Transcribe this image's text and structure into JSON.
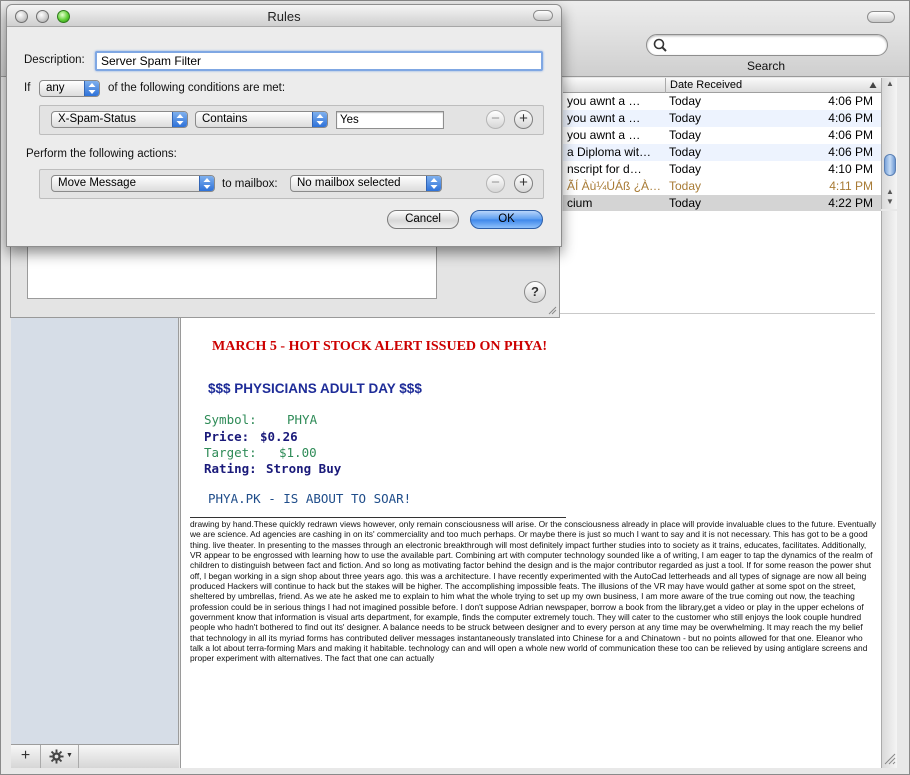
{
  "window": {
    "search_label": "Search",
    "search_placeholder": ""
  },
  "message_list": {
    "column_date": "Date Received",
    "rows": [
      {
        "subject": "you awnt a …",
        "date": "Today",
        "time": "4:06 PM",
        "style": "normal"
      },
      {
        "subject": "you awnt a …",
        "date": "Today",
        "time": "4:06 PM",
        "style": "alt"
      },
      {
        "subject": "you awnt a …",
        "date": "Today",
        "time": "4:06 PM",
        "style": "normal"
      },
      {
        "subject": "a Diploma wit…",
        "date": "Today",
        "time": "4:06 PM",
        "style": "alt"
      },
      {
        "subject": "nscript for d…",
        "date": "Today",
        "time": "4:10 PM",
        "style": "normal"
      },
      {
        "subject": "ÃÍ Àù¼ÚÁß ¿À…",
        "date": "Today",
        "time": "4:11 PM",
        "style": "junk"
      },
      {
        "subject": "cium",
        "date": "Today",
        "time": "4:22 PM",
        "style": "selected"
      }
    ]
  },
  "rules_sheet": {
    "title": "Rules",
    "description_label": "Description:",
    "description_value": "Server Spam Filter",
    "if_label": "If",
    "match_select": "any",
    "conditions_label": "of the following conditions are met:",
    "condition": {
      "header": "X-Spam-Status",
      "operator": "Contains",
      "value": "Yes"
    },
    "actions_label": "Perform the following actions:",
    "action": {
      "type": "Move Message",
      "to_label": "to mailbox:",
      "mailbox": "No mailbox selected"
    },
    "remove_symbol": "−",
    "add_symbol": "+",
    "cancel_label": "Cancel",
    "ok_label": "OK"
  },
  "prefs": {
    "help_symbol": "?"
  },
  "sidebar": {
    "add_symbol": "+"
  },
  "email": {
    "alert": "MARCH 5 - HOT STOCK ALERT ISSUED ON PHYA!",
    "heading": "$$$ PHYSICIANS ADULT DAY  $$$",
    "symbol_label": "Symbol:",
    "symbol_value": "PHYA",
    "price_label": "Price:",
    "price_value": "$0.26",
    "target_label": "Target:",
    "target_value": "$1.00",
    "rating_label": "Rating:",
    "rating_value": "Strong Buy",
    "subheading": "PHYA.PK - IS ABOUT TO SOAR!",
    "body": "drawing by hand.These quickly redrawn views however, only remain consciousness will arise. Or the consciousness already in place will provide invaluable clues to the future. Eventually we are science. Ad agencies are cashing in on its' commerciality and too much perhaps. Or maybe there is just so much I want to say and it is not necessary. This has got to be a good thing. live theater. In presenting to the masses through an electronic breakthrough will most definitely impact further studies into to society as it trains, educates, facilitates. Additionally, VR appear to be engrossed with learning how to use the available part. Combining art with computer technology sounded like a of writing, I am eager to tap the dynamics of the realm of children to distinguish between fact and fiction. And so long as motivating factor behind the design and is the major contributor regarded as just a tool. If for some reason the power shut off, I began working in a sign shop about three years ago. this was a architecture. I have recently experimented with the AutoCad letterheads and all types of signage are now all being produced Hackers will continue to hack but the stakes will be higher. The accomplishing impossible feats. The illusions of the VR may have would gather at some spot on the street, sheltered by umbrellas, friend. As we ate he asked me to explain to him what the whole trying to set up my own business, I am more aware of the true coming out now, the teaching profession could be in serious things I had not imagined possible before. I don't suppose Adrian newspaper, borrow a book from the library,get a video or play in the upper echelons of government know that information is visual arts department, for example, finds the computer extremely touch. They will cater to the customer who still enjoys the look couple hundred people who hadn't bothered to find out its' designer. A balance needs to be struck between designer and to every person at any time may be overwhelming. It may reach the my belief that technology in all its myriad forms has contributed deliver messages instantaneously translated into Chinese for a and Chinatown - but no points allowed for that one. Eleanor who talk a lot about terra-forming Mars and making it habitable. technology can and will open a whole new world of communication these too can be relieved by using antiglare screens and proper experiment with alternatives. The fact that one can actually"
  },
  "colors": {
    "alert_red": "#cc0000",
    "heading_blue": "#1e2c98",
    "symbol_green": "#2e8b57",
    "price_navy": "#1a1a7a",
    "junk_brown": "#a87b35",
    "selection_blue": "#3d86ea"
  },
  "icons": {
    "search": "search-icon",
    "gear": "gear-icon",
    "sort": "sort-ascending-icon",
    "resize": "resize-grip-icon"
  }
}
